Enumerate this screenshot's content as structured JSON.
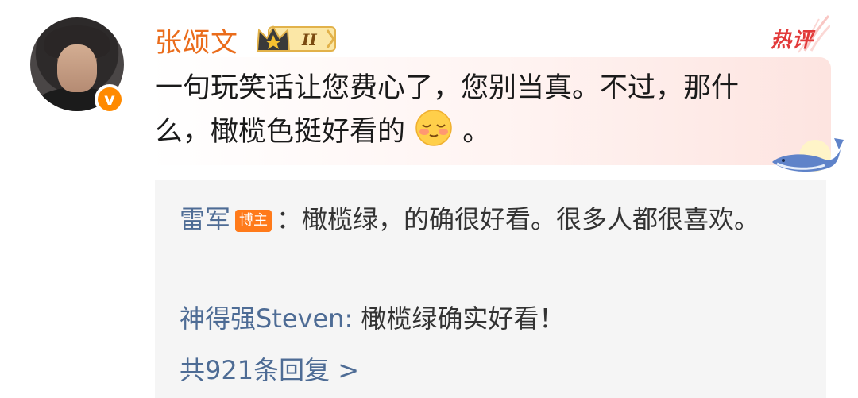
{
  "author": {
    "name": "张颂文",
    "verified_glyph": "v",
    "level_numeral": "II"
  },
  "hot_tag": "热评",
  "comment": {
    "text_before_emoji": "一句玩笑话让您费心了，您别当真。不过，那什么，橄榄色挺好看的",
    "emoji": "shy-smile-emoji",
    "text_after_emoji": "。"
  },
  "replies": [
    {
      "user": "雷军",
      "badge": "博主",
      "separator": "：",
      "text": "橄榄绿，的确很好看。很多人都很喜欢。"
    },
    {
      "user": "神得强Steven",
      "separator": ": ",
      "text": "橄榄绿确实好看！"
    }
  ],
  "more_replies": "共921条回复 >",
  "colors": {
    "name": "#ea6c1b",
    "link": "#4e6c95",
    "hot": "#e23a3a",
    "badge": "#ff7a1a"
  },
  "icons": [
    "crown-level-icon",
    "hot-comment-tag",
    "whale-decoration",
    "verified-v-icon"
  ]
}
